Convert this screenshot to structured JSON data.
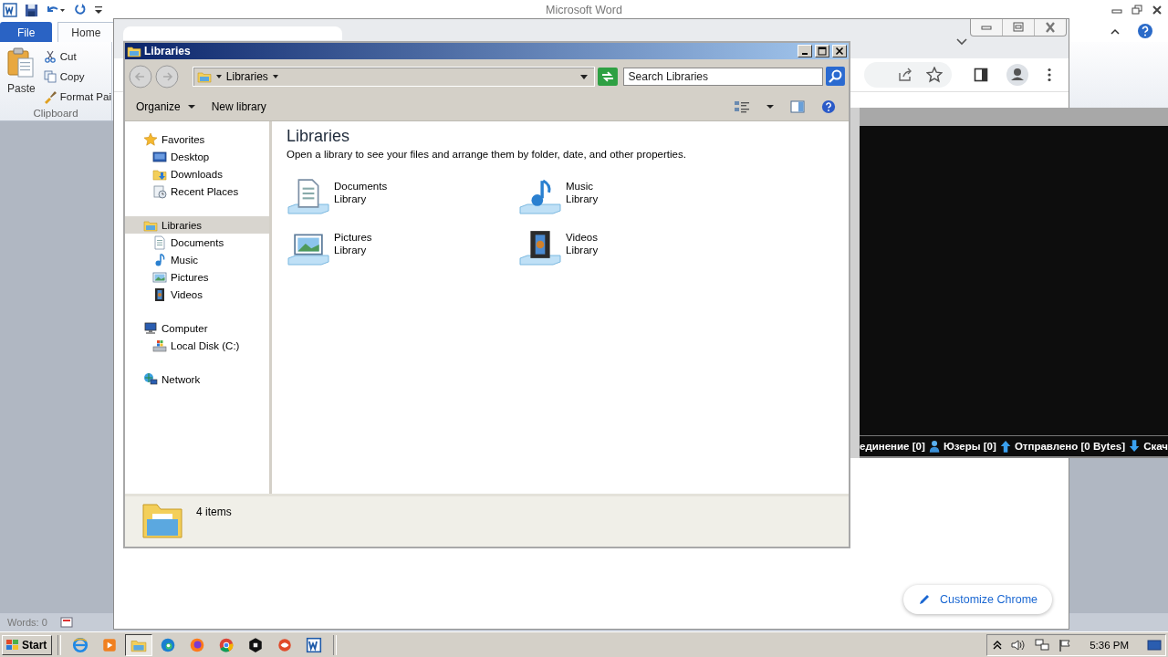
{
  "word": {
    "title": "Microsoft Word",
    "tabs": [
      {
        "label": "File",
        "kind": "file",
        "selected": false
      },
      {
        "label": "Home",
        "kind": "tab",
        "selected": true
      }
    ],
    "paste": "Paste",
    "clipboard_items": [
      {
        "label": "Cut",
        "kind": "scissors"
      },
      {
        "label": "Copy",
        "kind": "copy"
      },
      {
        "label": "Format Pai",
        "kind": "brush"
      }
    ],
    "group": "Clipboard",
    "status": "Words: 0"
  },
  "chrome": {
    "customize": "Customize Chrome"
  },
  "console": {
    "status": [
      {
        "text": "единение [0]",
        "kind": "plain"
      },
      {
        "text": "Юзеры [0]",
        "kind": "user"
      },
      {
        "text": "Отправлено [0 Bytes]",
        "kind": "up"
      },
      {
        "text": "Скач",
        "kind": "down"
      }
    ]
  },
  "explorer": {
    "title": "Libraries",
    "breadcrumb": "Libraries",
    "search": {
      "placeholder": "Search Libraries"
    },
    "toolbar": [
      "Organize",
      "New library"
    ],
    "nav": [
      {
        "label": "Favorites",
        "kind": "star",
        "selected": false,
        "children": [
          {
            "label": "Desktop",
            "kind": "desktop",
            "selected": false
          },
          {
            "label": "Downloads",
            "kind": "downloads",
            "selected": false
          },
          {
            "label": "Recent Places",
            "kind": "recent",
            "selected": false
          }
        ]
      },
      {
        "label": "Libraries",
        "kind": "libraries",
        "selected": true,
        "children": [
          {
            "label": "Documents",
            "kind": "documents",
            "selected": false
          },
          {
            "label": "Music",
            "kind": "music",
            "selected": false
          },
          {
            "label": "Pictures",
            "kind": "pictures",
            "selected": false
          },
          {
            "label": "Videos",
            "kind": "videos",
            "selected": false
          }
        ]
      },
      {
        "label": "Computer",
        "kind": "computer",
        "selected": false,
        "children": [
          {
            "label": "Local Disk (C:)",
            "kind": "disk",
            "selected": false
          }
        ]
      },
      {
        "label": "Network",
        "kind": "network",
        "selected": false
      }
    ],
    "heading": "Libraries",
    "description": "Open a library to see your files and arrange them by folder, date, and other properties.",
    "libraries": [
      {
        "name": "Documents",
        "type": "Library",
        "kind": "documents"
      },
      {
        "name": "Music",
        "type": "Library",
        "kind": "music"
      },
      {
        "name": "Pictures",
        "type": "Library",
        "kind": "pictures"
      },
      {
        "name": "Videos",
        "type": "Library",
        "kind": "videos"
      }
    ],
    "status": "4 items"
  },
  "taskbar": {
    "start": "Start",
    "apps": [
      {
        "kind": "ie",
        "selected": false
      },
      {
        "kind": "media",
        "selected": false
      },
      {
        "kind": "explorer",
        "selected": true
      },
      {
        "kind": "edge",
        "selected": false
      },
      {
        "kind": "firefox",
        "selected": false
      },
      {
        "kind": "chrome",
        "selected": false
      },
      {
        "kind": "darkapp",
        "selected": false
      },
      {
        "kind": "redapp",
        "selected": false
      },
      {
        "kind": "word",
        "selected": false
      }
    ],
    "clock": "5:36 PM"
  }
}
